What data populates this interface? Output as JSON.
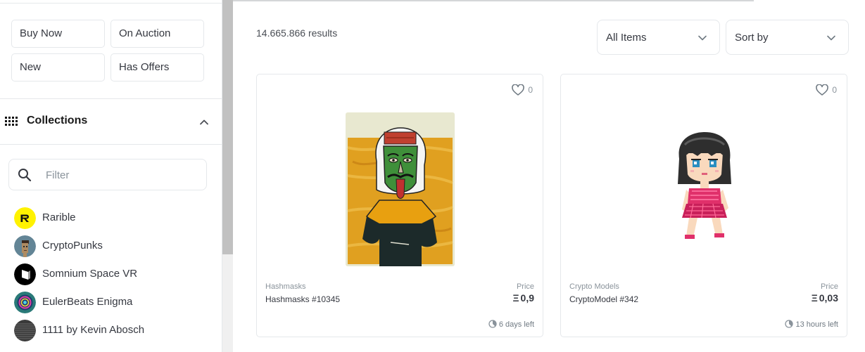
{
  "sidebar": {
    "status_buttons": [
      "Buy Now",
      "On Auction",
      "New",
      "Has Offers"
    ],
    "collections_title": "Collections",
    "filter_placeholder": "Filter",
    "collections": [
      {
        "label": "Rarible",
        "avatar_color": "#fff200"
      },
      {
        "label": "CryptoPunks",
        "avatar_color": "#638596"
      },
      {
        "label": "Somnium Space VR",
        "avatar_color": "#000000"
      },
      {
        "label": "EulerBeats Enigma",
        "avatar_color": "#2a7a78"
      },
      {
        "label": "1111 by Kevin Abosch",
        "avatar_color": "#3a3a3a"
      }
    ]
  },
  "main": {
    "result_count": "14.665.866 results",
    "dropdowns": {
      "items": "All Items",
      "sort": "Sort by"
    }
  },
  "cards": [
    {
      "collection": "Hashmasks",
      "name": "Hashmasks #10345",
      "price_label": "Price",
      "currency": "Ξ",
      "price": "0,9",
      "time_left": "6 days left",
      "likes": "0"
    },
    {
      "collection": "Crypto Models",
      "name": "CryptoModel #342",
      "price_label": "Price",
      "currency": "Ξ",
      "price": "0,03",
      "time_left": "13 hours left",
      "likes": "0"
    }
  ],
  "icons": {
    "grid": "grid-icon",
    "collapse": "chevron-up-icon",
    "search": "search-icon",
    "dropdown": "chevron-down-icon",
    "favorite": "heart-icon",
    "time": "clock-icon"
  }
}
